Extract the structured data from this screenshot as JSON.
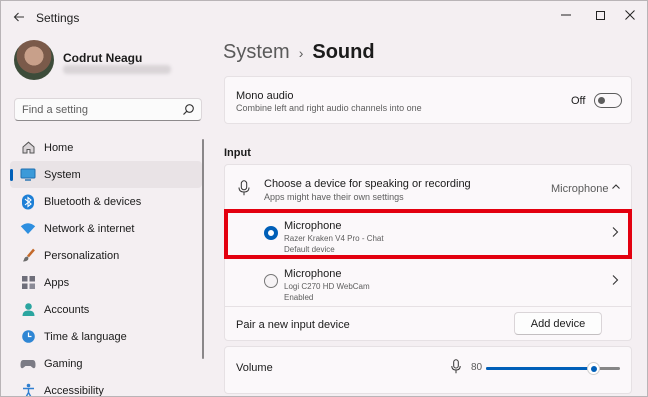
{
  "window": {
    "title": "Settings",
    "controls": [
      "minimize",
      "maximize",
      "close"
    ]
  },
  "user": {
    "name": "Codrut Neagu"
  },
  "search": {
    "placeholder": "Find a setting",
    "icon": "search-icon"
  },
  "sidebar": {
    "items": [
      {
        "label": "Home",
        "icon": "home-icon",
        "active": false
      },
      {
        "label": "System",
        "icon": "system-icon",
        "active": true
      },
      {
        "label": "Bluetooth & devices",
        "icon": "bluetooth-icon",
        "active": false
      },
      {
        "label": "Network & internet",
        "icon": "wifi-icon",
        "active": false
      },
      {
        "label": "Personalization",
        "icon": "brush-icon",
        "active": false
      },
      {
        "label": "Apps",
        "icon": "apps-icon",
        "active": false
      },
      {
        "label": "Accounts",
        "icon": "accounts-icon",
        "active": false
      },
      {
        "label": "Time & language",
        "icon": "globe-clock-icon",
        "active": false
      },
      {
        "label": "Gaming",
        "icon": "gamepad-icon",
        "active": false
      },
      {
        "label": "Accessibility",
        "icon": "accessibility-icon",
        "active": false
      }
    ]
  },
  "breadcrumb": {
    "parent": "System",
    "separator": "›",
    "current": "Sound"
  },
  "mono_audio": {
    "title": "Mono audio",
    "description": "Combine left and right audio channels into one",
    "state_label": "Off",
    "enabled": false
  },
  "input": {
    "section_title": "Input",
    "choose": {
      "title": "Choose a device for speaking or recording",
      "description": "Apps might have their own settings",
      "value": "Microphone"
    },
    "devices": [
      {
        "name": "Microphone",
        "sub": "Razer Kraken V4 Pro - Chat",
        "status": "Default device",
        "selected": true
      },
      {
        "name": "Microphone",
        "sub": "Logi C270 HD WebCam",
        "status": "Enabled",
        "selected": false
      }
    ],
    "pair": {
      "label": "Pair a new input device",
      "button": "Add device"
    }
  },
  "volume": {
    "label": "Volume",
    "value": "80",
    "level": 0.8
  },
  "colors": {
    "accent": "#005fb8",
    "highlight": "#e3000f",
    "background": "#f4eff2"
  }
}
